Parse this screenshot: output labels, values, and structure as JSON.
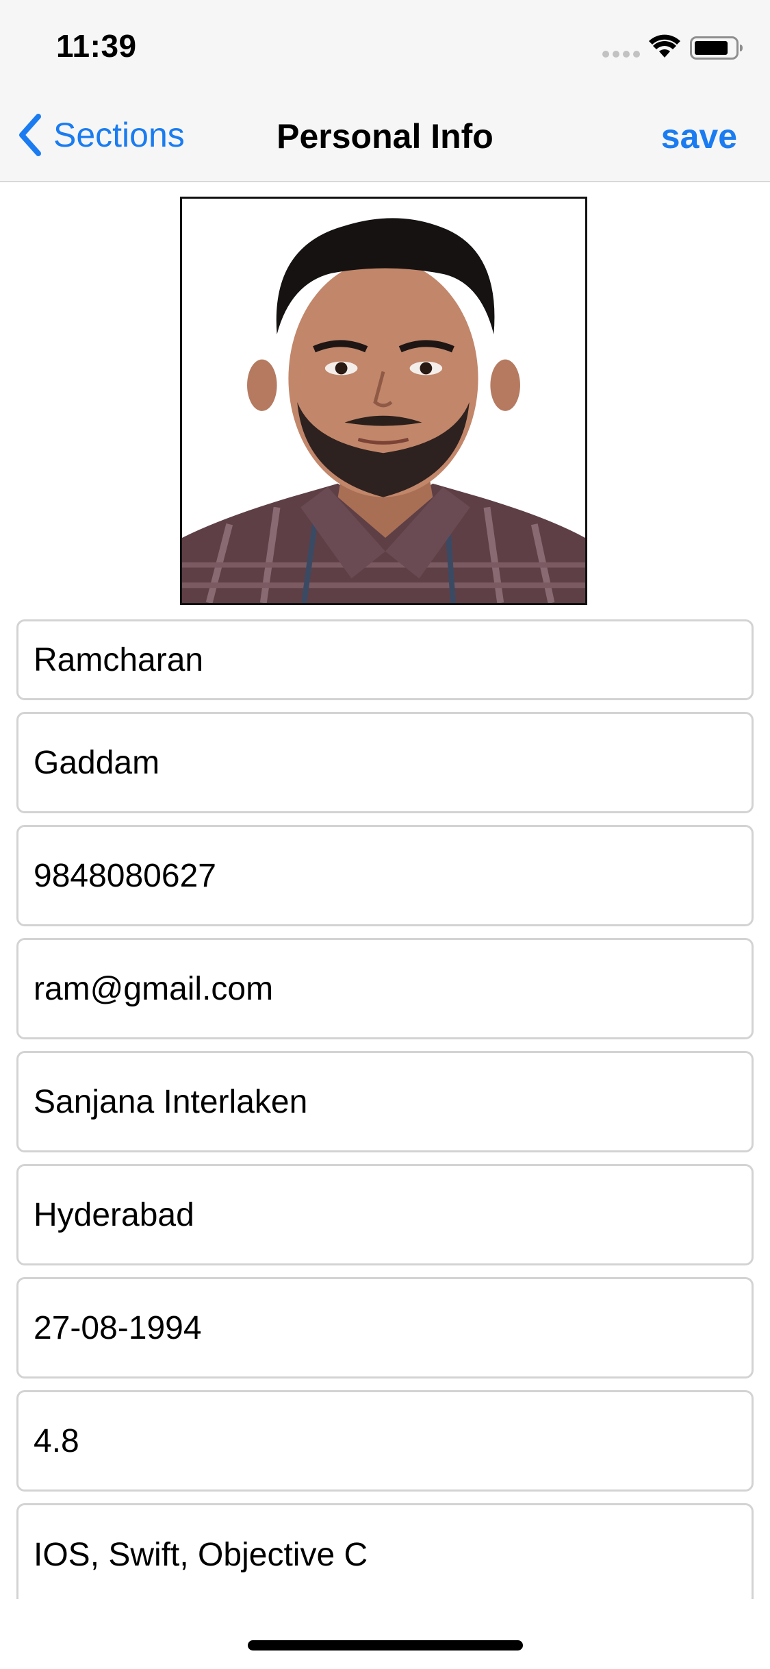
{
  "status_bar": {
    "time": "11:39",
    "signal_icon": "cellular-signal-dots-icon",
    "wifi_icon": "wifi-icon",
    "battery_icon": "battery-icon"
  },
  "nav": {
    "back_label": "Sections",
    "back_icon": "chevron-left-icon",
    "title": "Personal Info",
    "save_label": "save",
    "accent_color": "#1a7cf0"
  },
  "profile_photo": {
    "type": "photo-of-person-plaid-shirt"
  },
  "fields": [
    {
      "value": "Ramcharan"
    },
    {
      "value": "Gaddam"
    },
    {
      "value": "9848080627"
    },
    {
      "value": "ram@gmail.com"
    },
    {
      "value": "Sanjana Interlaken"
    },
    {
      "value": "Hyderabad"
    },
    {
      "value": "27-08-1994"
    },
    {
      "value": "4.8"
    },
    {
      "value": "IOS, Swift, Objective C"
    }
  ]
}
